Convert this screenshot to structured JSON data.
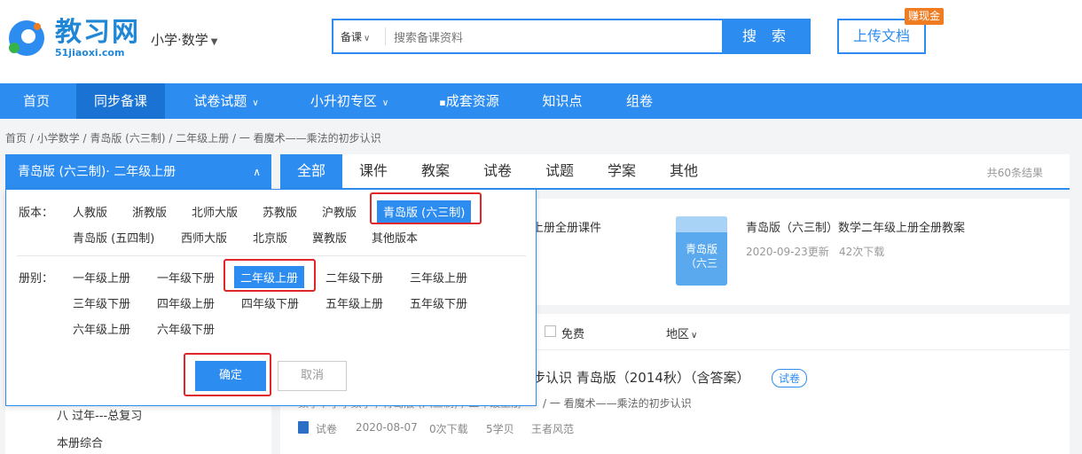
{
  "logo": {
    "title": "教习网",
    "domain": "51jiaoxi.com"
  },
  "subject_selector": {
    "label": "小学·数学"
  },
  "search": {
    "type_label": "备课",
    "placeholder": "搜索备课资料",
    "button_label": "搜 索"
  },
  "upload": {
    "label": "上传文档",
    "badge": "赚现金"
  },
  "nav": {
    "items": [
      {
        "label": "首页"
      },
      {
        "label": "同步备课"
      },
      {
        "label": "试卷试题"
      },
      {
        "label": "小升初专区"
      },
      {
        "label": "成套资源"
      },
      {
        "label": "知识点"
      },
      {
        "label": "组卷"
      }
    ]
  },
  "breadcrumb": "首页 /  小学数学 / 青岛版 (六三制) / 二年级上册 / 一 看魔术——乘法的初步认识",
  "selector": {
    "title": "青岛版 (六三制)· 二年级上册",
    "edition_label": "版本：",
    "editions_row1": [
      "人教版",
      "浙教版",
      "北师大版",
      "苏教版",
      "沪教版",
      "青岛版 (六三制)"
    ],
    "editions_row2": [
      "青岛版 (五四制)",
      "西师大版",
      "北京版",
      "冀教版",
      "其他版本"
    ],
    "volume_label": "册别：",
    "volumes_row1": [
      "一年级上册",
      "一年级下册",
      "二年级上册",
      "二年级下册",
      "三年级上册"
    ],
    "volumes_row2": [
      "三年级下册",
      "四年级上册",
      "四年级下册",
      "五年级上册",
      "五年级下册"
    ],
    "volumes_row3": [
      "六年级上册",
      "六年级下册"
    ],
    "confirm": "确定",
    "cancel": "取消"
  },
  "left_list": [
    "八 过年---总复习",
    "本册综合"
  ],
  "tabs": {
    "items": [
      "全部",
      "课件",
      "教案",
      "试卷",
      "试题",
      "学案",
      "其他"
    ],
    "count": "共60条结果"
  },
  "featured": {
    "left_title_tail": "上册全册课件",
    "right_title": "青岛版（六三制）数学二年级上册全册教案",
    "right_date": "2020-09-23更新",
    "right_downloads": "42次下载",
    "cover_text1": "青岛版",
    "cover_text2": "（六三"
  },
  "filters": {
    "free": "免费",
    "region": "地区"
  },
  "result": {
    "title_tail": "步认识 青岛版（2014秋）（含答案）",
    "tag": "试卷",
    "path_tail": "/ 一 看魔术——乘法的初步认识",
    "path_head": "数学 / 小学数学 / 青岛版 (六三制) / 二年级上册",
    "type": "试卷",
    "date": "2020-08-07",
    "downloads": "0次下载",
    "pages": "5学贝",
    "author": "王者风范"
  }
}
